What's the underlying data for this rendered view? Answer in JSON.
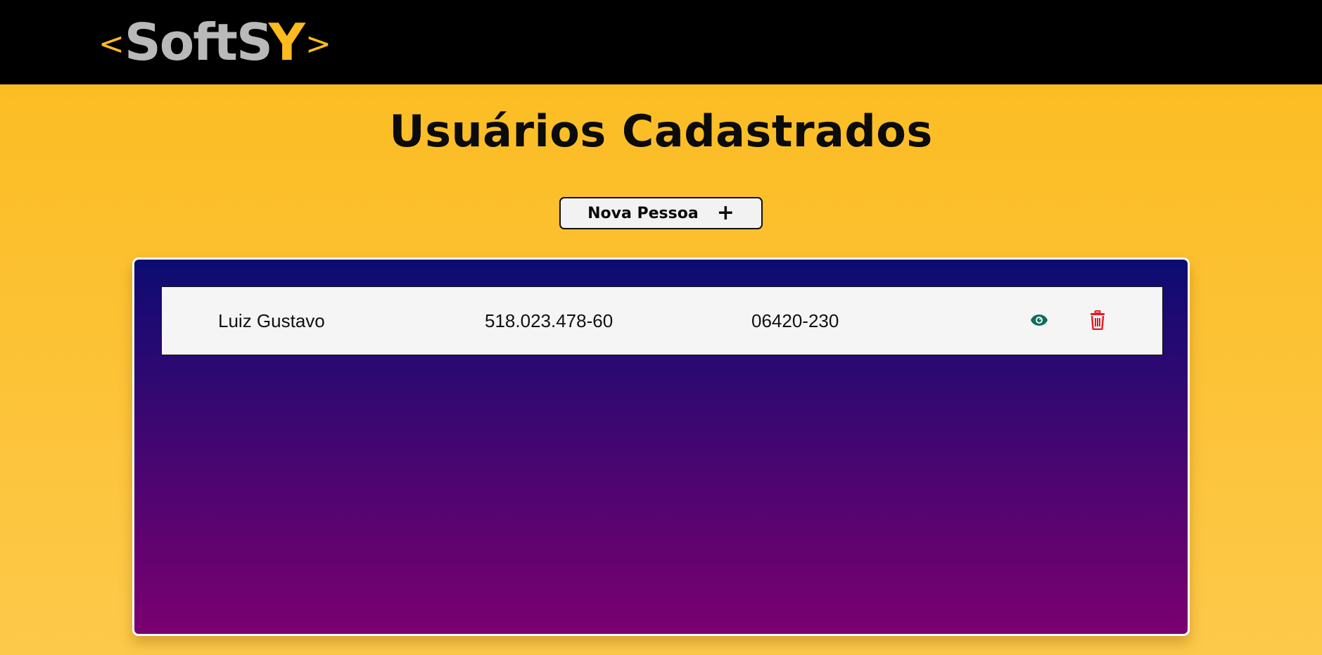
{
  "header": {
    "logo": {
      "open_bracket": "<",
      "text": "SoftS",
      "accent_letter": "Y",
      "close_bracket": ">"
    }
  },
  "main": {
    "title": "Usuários Cadastrados",
    "new_button_label": "Nova Pessoa",
    "new_button_icon": "plus-icon"
  },
  "users": [
    {
      "name": "Luiz Gustavo",
      "cpf": "518.023.478-60",
      "cep": "06420-230",
      "actions": [
        "eye-icon",
        "trash-icon"
      ]
    }
  ],
  "colors": {
    "header_bg": "#000000",
    "page_bg_top": "#fcbb1e",
    "page_bg_bottom": "#fdc94a",
    "logo_gray": "#b9b9b9",
    "logo_accent": "#fcbb1e",
    "panel_top": "#0c0c72",
    "panel_bottom": "#7b0070",
    "view_icon": "#0f6b5e",
    "delete_icon": "#e31b23"
  }
}
